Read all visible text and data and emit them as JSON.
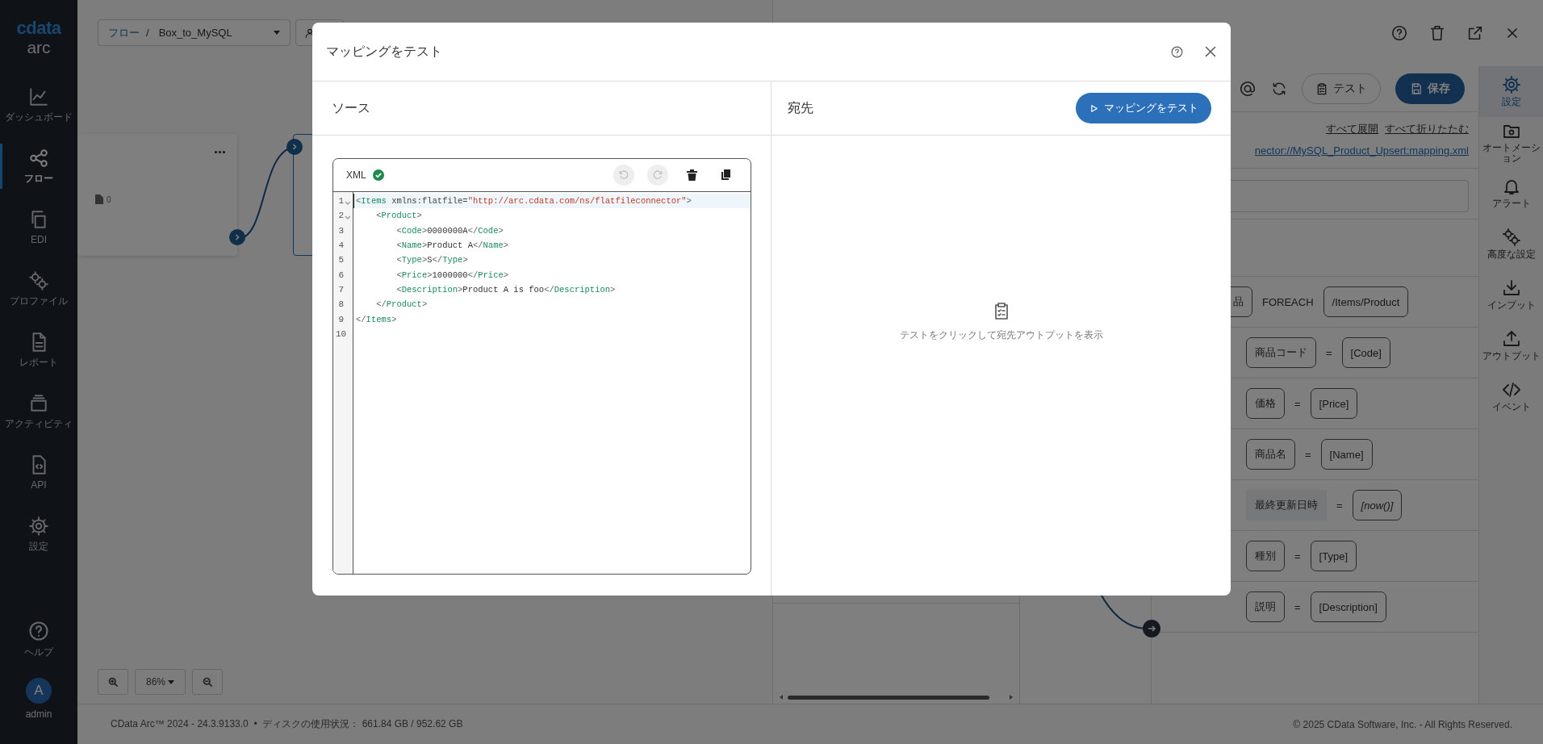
{
  "sidebar": {
    "logo": {
      "brand": "cdata",
      "product": "arc"
    },
    "items": [
      {
        "label": "ダッシュボード",
        "selected": false
      },
      {
        "label": "フロー",
        "selected": true
      },
      {
        "label": "EDI",
        "selected": false
      },
      {
        "label": "プロファイル",
        "selected": false
      },
      {
        "label": "レポート",
        "selected": false
      },
      {
        "label": "アクティビティ",
        "selected": false
      },
      {
        "label": "API",
        "selected": false
      },
      {
        "label": "設定",
        "selected": false
      }
    ],
    "help": "ヘルプ",
    "user": {
      "initial": "A",
      "name": "admin"
    }
  },
  "flow": {
    "breadcrumb": {
      "parent": "フロー",
      "separator": "/",
      "name": "Box_to_MySQL"
    },
    "node": {
      "file_count": "0"
    },
    "zoom": "86%"
  },
  "panel": {
    "toolbar": {
      "test": "テスト",
      "save": "保存"
    },
    "links": [
      "すべて展開",
      "すべて折りたたむ"
    ],
    "path": "nector://MySQL_Product_Upsert:mapping.xml",
    "foreach": {
      "target": "品",
      "keyword": "FOREACH",
      "source": "/Items/Product"
    },
    "mappings": [
      {
        "target": "商品コード",
        "operator": "=",
        "source": "[Code]",
        "boxed": true,
        "italic": false
      },
      {
        "target": "価格",
        "operator": "=",
        "source": "[Price]",
        "boxed": true,
        "italic": false
      },
      {
        "target": "商品名",
        "operator": "=",
        "source": "[Name]",
        "boxed": true,
        "italic": false
      },
      {
        "target": "最終更新日時",
        "operator": "=",
        "source": "[now()]",
        "boxed": false,
        "italic": true
      },
      {
        "target": "種別",
        "operator": "=",
        "source": "[Type]",
        "boxed": true,
        "italic": false
      },
      {
        "target": "説明",
        "operator": "=",
        "source": "[Description]",
        "boxed": true,
        "italic": false
      }
    ],
    "side_tabs": [
      {
        "label": "設定",
        "selected": true
      },
      {
        "label": "オートメーション",
        "selected": false
      },
      {
        "label": "アラート",
        "selected": false
      },
      {
        "label": "高度な設定",
        "selected": false
      },
      {
        "label": "インプット",
        "selected": false
      },
      {
        "label": "アウトプット",
        "selected": false
      },
      {
        "label": "イベント",
        "selected": false
      }
    ]
  },
  "modal": {
    "title": "マッピングをテスト",
    "source": {
      "heading": "ソース",
      "editor": {
        "language": "XML",
        "valid": true,
        "undo_disabled": true,
        "redo_disabled": true,
        "lines": [
          {
            "n": "1",
            "text": "<Items xmlns:flatfile=\"http://arc.cdata.com/ns/flatfileconnector\">",
            "fold": true,
            "current": true,
            "children": [
              {
                "n": "2",
                "text": "<Product>",
                "fold": true,
                "current": false,
                "children": [
                  {
                    "n": "3",
                    "text": "<Code>0000000A</Code>",
                    "fold": false,
                    "current": false
                  },
                  {
                    "n": "4",
                    "text": "<Name>Product A</Name>",
                    "fold": false,
                    "current": false
                  },
                  {
                    "n": "5",
                    "text": "<Type>S</Type>",
                    "fold": false,
                    "current": false
                  },
                  {
                    "n": "6",
                    "text": "<Price>1000000</Price>",
                    "fold": false,
                    "current": false
                  },
                  {
                    "n": "7",
                    "text": "<Description>Product A is foo</Description>",
                    "fold": false,
                    "current": false
                  }
                ]
              },
              {
                "n": "8",
                "text": "</Product>",
                "fold": false,
                "current": false
              }
            ]
          },
          {
            "n": "9",
            "text": "</Items>",
            "fold": false,
            "current": false
          },
          {
            "n": "10",
            "fold": false,
            "current": false
          }
        ]
      }
    },
    "destination": {
      "heading": "宛先",
      "button": "マッピングをテスト",
      "empty_message": "テストをクリックして宛先アウトプットを表示"
    }
  },
  "status_bar": {
    "version": "CData Arc™ 2024 - 24.3.9133.0  •  ディスクの使用状況： 661.84 GB / 952.62 GB",
    "copyright": "© 2025 CData Software, Inc. - All Rights Reserved."
  }
}
